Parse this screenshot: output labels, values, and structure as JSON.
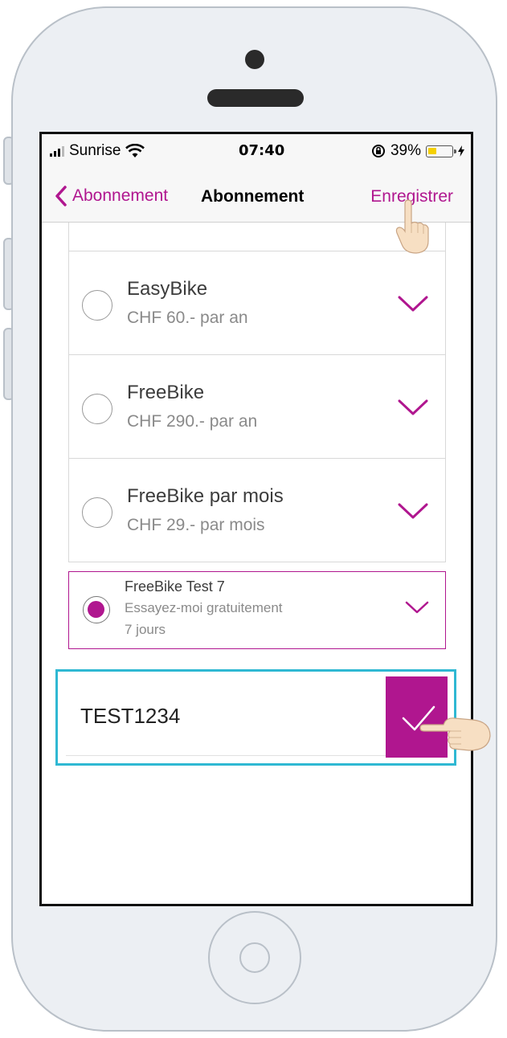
{
  "status_bar": {
    "carrier": "Sunrise",
    "time": "07:40",
    "battery_percent": "39%",
    "icons": [
      "signal-icon",
      "wifi-icon",
      "rotation-lock-icon",
      "battery-icon",
      "charging-icon"
    ]
  },
  "nav": {
    "back_label": "Abonnement",
    "title": "Abonnement",
    "save_label": "Enregistrer"
  },
  "subscriptions": [
    {
      "name": "EasyBike",
      "price": "CHF 60.- par an",
      "selected": false
    },
    {
      "name": "FreeBike",
      "price": "CHF 290.- par an",
      "selected": false
    },
    {
      "name": "FreeBike par mois",
      "price": "CHF 29.- par mois",
      "selected": false
    }
  ],
  "selected_subscription": {
    "name": "FreeBike Test 7",
    "subtitle": "Essayez-moi gratuitement",
    "duration": "7 jours",
    "selected": true
  },
  "promo_code": {
    "value": "TEST1234"
  },
  "colors": {
    "accent": "#b0168f",
    "highlight": "#2fb8d3",
    "muted_text": "#8a8a8a"
  }
}
